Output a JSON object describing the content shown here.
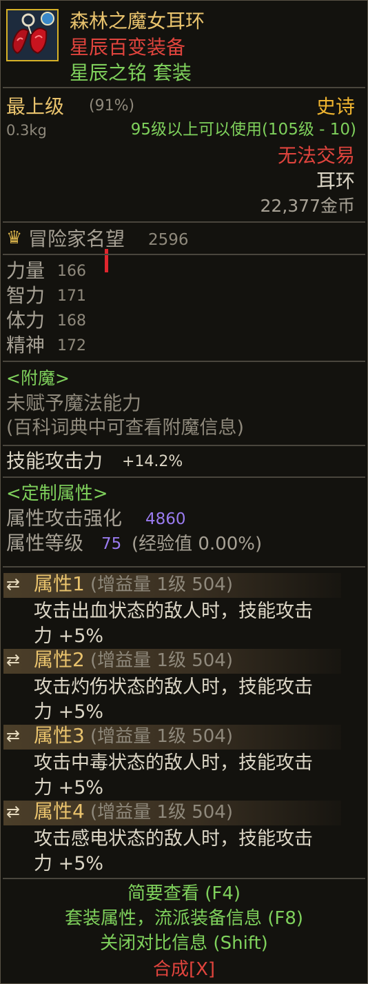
{
  "item": {
    "name": "森林之魔女耳环",
    "subtitle": "星辰百变装备",
    "set_name": "星辰之铭 套装",
    "grade": "最上级",
    "grade_percent": "(91%)",
    "rarity": "史诗",
    "weight": "0.3kg",
    "level_requirement": "95级以上可以使用(105级 - 10)",
    "trade_status": "无法交易",
    "slot": "耳环",
    "price": "22,377金币"
  },
  "reputation": {
    "label": "冒险家名望",
    "value": "2596"
  },
  "stats": [
    {
      "label": "力量",
      "value": "166"
    },
    {
      "label": "智力",
      "value": "171"
    },
    {
      "label": "体力",
      "value": "168"
    },
    {
      "label": "精神",
      "value": "172"
    }
  ],
  "enchant": {
    "header": "<附魔>",
    "line1": "未赋予魔法能力",
    "line2": "(百科词典中可查看附魔信息)"
  },
  "skill_attack": {
    "label": "技能攻击力",
    "value": "+14.2%"
  },
  "custom": {
    "header": "<定制属性>",
    "elem_label": "属性攻击强化",
    "elem_value": "4860",
    "level_label": "属性等级",
    "level_value": "75",
    "exp_text": "(经验值 0.00%)"
  },
  "attributes": [
    {
      "name": "属性1",
      "tier": "(增益量 1级 504)",
      "desc1": "攻击出血状态的敌人时，技能攻击",
      "desc2": "力 +5%"
    },
    {
      "name": "属性2",
      "tier": "(增益量 1级 504)",
      "desc1": "攻击灼伤状态的敌人时，技能攻击",
      "desc2": "力 +5%"
    },
    {
      "name": "属性3",
      "tier": "(增益量 1级 504)",
      "desc1": "攻击中毒状态的敌人时，技能攻击",
      "desc2": "力 +5%"
    },
    {
      "name": "属性4",
      "tier": "(增益量 1级 504)",
      "desc1": "攻击感电状态的敌人时，技能攻击",
      "desc2": "力 +5%"
    }
  ],
  "footer": {
    "brief": "简要查看 (F4)",
    "set_info": "套装属性，流派装备信息 (F8)",
    "close_compare": "关闭对比信息 (Shift)",
    "synthesize": "合成[X]"
  },
  "colors": {
    "name": "#e9c36d",
    "subtitle": "#e0443d",
    "set": "#7fd15c",
    "rarity": "#f0b530",
    "purple_value": "#9a7bf0"
  }
}
